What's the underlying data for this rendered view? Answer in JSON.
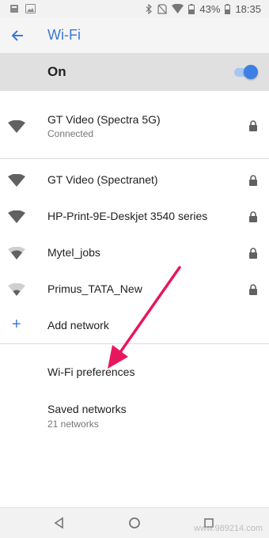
{
  "status_bar": {
    "battery_percent": "43%",
    "time": "18:35",
    "icons": [
      "notification-icon",
      "image-icon",
      "bluetooth-icon",
      "no-sim-icon",
      "wifi-signal-icon",
      "battery-icon"
    ]
  },
  "header": {
    "title": "Wi-Fi",
    "back_icon": "arrow-back-icon"
  },
  "toggle": {
    "label": "On",
    "state": true,
    "accent_color": "#3d7fe3"
  },
  "networks": [
    {
      "name": "GT Video (Spectra 5G)",
      "status": "Connected",
      "secured": true,
      "signal": "full"
    },
    {
      "name": "GT Video (Spectranet)",
      "secured": true,
      "signal": "full"
    },
    {
      "name": "HP-Print-9E-Deskjet 3540 series",
      "secured": true,
      "signal": "full"
    },
    {
      "name": "Mytel_jobs",
      "secured": true,
      "signal": "medium"
    },
    {
      "name": "Primus_TATA_New",
      "secured": true,
      "signal": "low"
    }
  ],
  "add_network": {
    "label": "Add network",
    "icon": "plus-icon"
  },
  "preferences": {
    "wifi_preferences": "Wi-Fi preferences",
    "saved_networks": "Saved networks",
    "saved_networks_count": "21 networks"
  },
  "annotation": {
    "color": "#e8175d"
  },
  "watermark": "www.989214.com",
  "nav": {
    "back": "back-triangle-icon",
    "home": "home-circle-icon",
    "recents": "recents-square-icon"
  }
}
